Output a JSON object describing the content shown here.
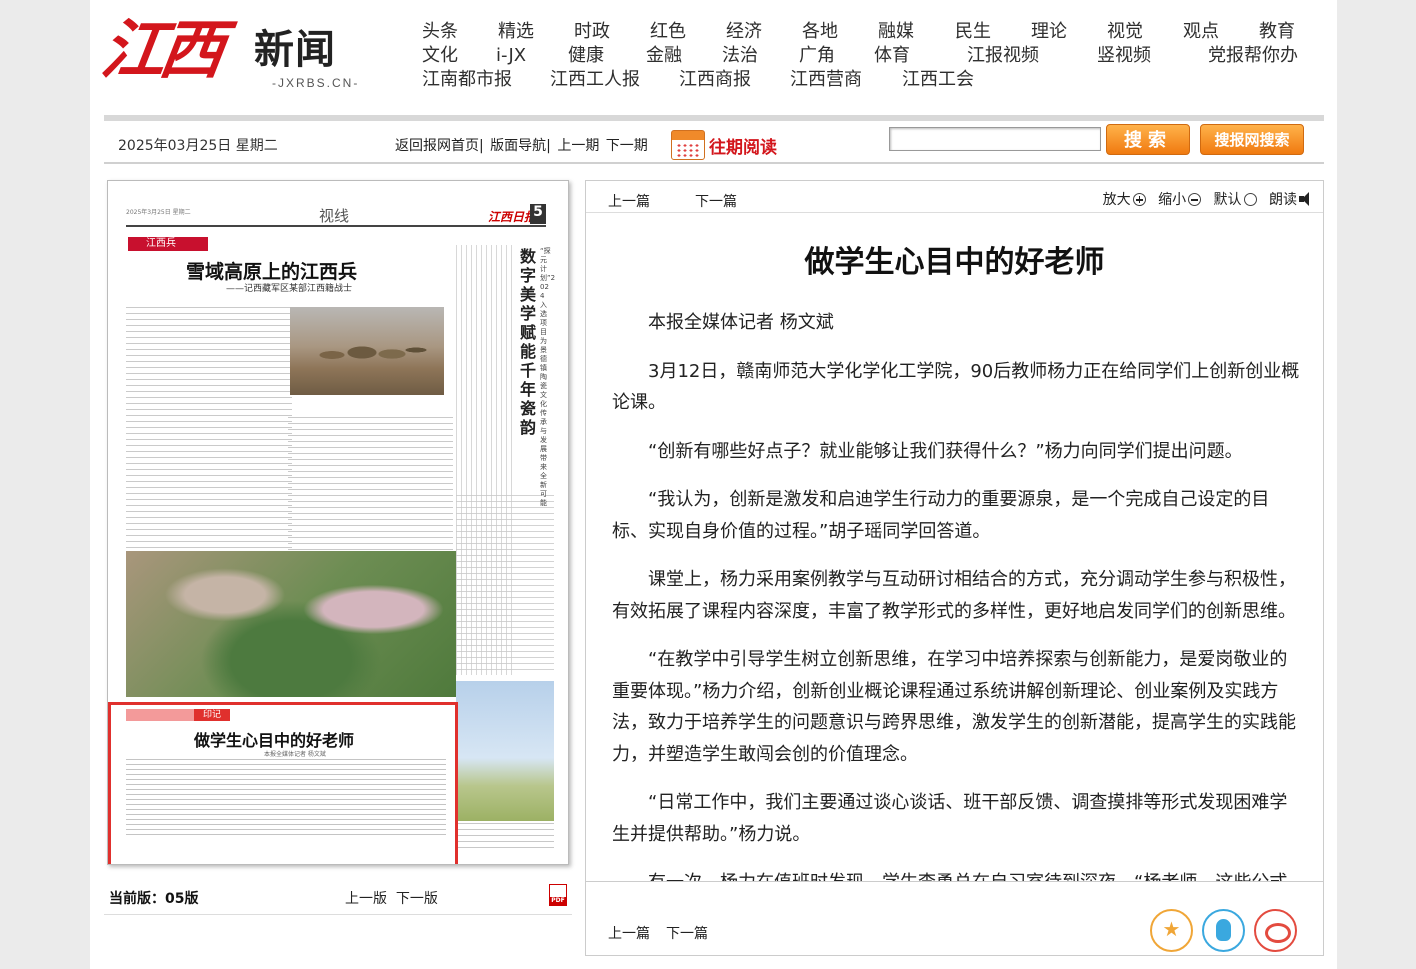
{
  "header": {
    "logo_main": "江西",
    "logo_sub": "新闻",
    "logo_url": "-JXRBS.CN-",
    "nav_rows": [
      [
        "头条",
        "精选",
        "时政",
        "红色",
        "经济",
        "各地",
        "融媒",
        "民生",
        "理论",
        "视觉",
        "观点",
        "教育"
      ],
      [
        "文化",
        "i-JX",
        "健康",
        "金融",
        "法治",
        "广角",
        "体育",
        "江报视频",
        "竖视频",
        "党报帮你办"
      ],
      [
        "江南都市报",
        "江西工人报",
        "江西商报",
        "江西营商",
        "江西工会"
      ]
    ]
  },
  "toolbar": {
    "date": "2025年03月25日 星期二",
    "links": [
      "返回报网首页|",
      "版面导航|",
      "上一期",
      "下一期"
    ],
    "past_read": "往期阅读",
    "search_placeholder": "",
    "search_button": "搜索",
    "site_search_button": "搜报网搜索"
  },
  "paper": {
    "section": "视线",
    "masthead": "江西日报",
    "page_num": "5",
    "tiny_header": "2025年3月25日 星期二",
    "tag": "江西兵",
    "headline": "雪域高原上的江西兵",
    "subhead": "——记西藏军区某部江西籍战士",
    "vertical_title": "数字美学赋能千年瓷韵",
    "vertical_sub": "“探元计划”2024入选项目为景德镇陶瓷文化传承与发展带来全新可能",
    "highlight_tag": "印记",
    "highlight_title": "做学生心目中的好老师",
    "highlight_byline": "本报全媒体记者 杨文斌"
  },
  "below_paper": {
    "current_label": "当前版：",
    "current_value": "05版",
    "prev_edition": "上一版",
    "next_edition": "下一版"
  },
  "article": {
    "prev": "上一篇",
    "next": "下一篇",
    "tools": {
      "zoom_in": "放大",
      "zoom_out": "缩小",
      "default": "默认",
      "read_aloud": "朗读"
    },
    "title": "做学生心目中的好老师",
    "paragraphs": [
      "本报全媒体记者 杨文斌",
      "3月12日，赣南师范大学化学化工学院，90后教师杨力正在给同学们上创新创业概论课。",
      "“创新有哪些好点子？就业能够让我们获得什么？”杨力向同学们提出问题。",
      "“我认为，创新是激发和启迪学生行动力的重要源泉，是一个完成自己设定的目标、实现自身价值的过程。”胡子瑶同学回答道。",
      "课堂上，杨力采用案例教学与互动研讨相结合的方式，充分调动学生参与积极性，有效拓展了课程内容深度，丰富了教学形式的多样性，更好地启发同学们的创新思维。",
      "“在教学中引导学生树立创新思维，在学习中培养探索与创新能力，是爱岗敬业的重要体现。”杨力介绍，创新创业概论课程通过系统讲解创新理论、创业案例及实践方法，致力于培养学生的问题意识与跨界思维，激发学生的创新潜能，提高学生的实践能力，并塑造学生敢闯会创的价值理念。",
      "“日常工作中，我们主要通过谈心谈话、班干部反馈、调查摸排等形式发现困难学生并提供帮助。”杨力说。",
      "有一次，杨力在值班时发现，学生李勇总在自习室待到深夜。“杨老师，这些公式就"
    ],
    "bottom_prev": "上一篇",
    "bottom_next": "下一篇"
  },
  "colors": {
    "brand_red": "#d3161c",
    "accent_orange": "#f07a10",
    "highlight_border": "#e0302d"
  }
}
